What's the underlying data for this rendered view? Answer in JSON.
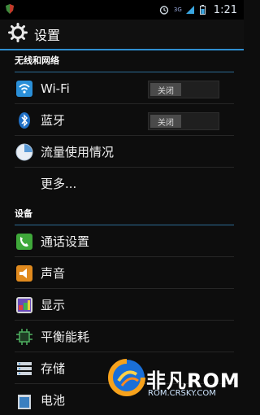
{
  "status_bar": {
    "time": "1:21",
    "network": "3G"
  },
  "header": {
    "title": "设置"
  },
  "sections": {
    "wireless": "无线和网络",
    "device": "设备"
  },
  "rows": {
    "wifi": {
      "label": "Wi-Fi",
      "toggle": "关闭"
    },
    "bluetooth": {
      "label": "蓝牙",
      "toggle": "关闭"
    },
    "data_usage": {
      "label": "流量使用情况"
    },
    "more": {
      "label": "更多..."
    },
    "call_settings": {
      "label": "通话设置"
    },
    "sound": {
      "label": "声音"
    },
    "display": {
      "label": "显示"
    },
    "power_saving": {
      "label": "平衡能耗"
    },
    "storage": {
      "label": "存储"
    },
    "battery": {
      "label": "电池"
    }
  },
  "watermark": {
    "brand": "非凡ROM",
    "site": "ROM.CRSKY.COM"
  },
  "colors": {
    "accent": "#2f8fd0",
    "background": "#0d0d0d"
  }
}
